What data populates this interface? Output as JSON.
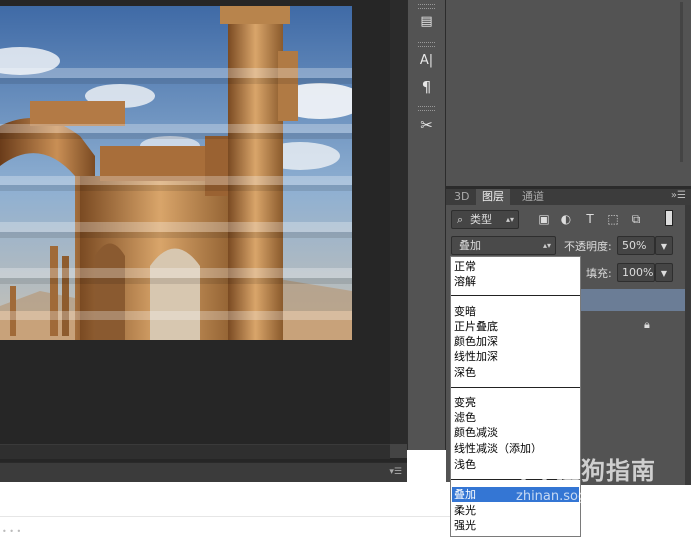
{
  "tools": [
    {
      "icon": "layer-comps-icon",
      "glyph": "▤"
    },
    {
      "icon": "character-icon",
      "glyph": "A|"
    },
    {
      "icon": "paragraph-icon",
      "glyph": "¶"
    },
    {
      "icon": "tool-presets-icon",
      "glyph": "✂"
    }
  ],
  "panel_tabs": [
    "3D",
    "图层",
    "通道"
  ],
  "active_tab": "图层",
  "layers": {
    "filter_type_label": "类型",
    "filter_icons": [
      "image-filter-icon",
      "adjustment-filter-icon",
      "type-filter-icon",
      "shape-filter-icon",
      "smart-object-filter-icon"
    ],
    "blend_mode": "叠加",
    "opacity_label": "不透明度:",
    "opacity_value": "50%",
    "fill_label": "填充:",
    "fill_value": "100%"
  },
  "blend_modes": {
    "group1": [
      "正常",
      "溶解"
    ],
    "group2": [
      "变暗",
      "正片叠底",
      "颜色加深",
      "线性加深",
      "深色"
    ],
    "group3": [
      "变亮",
      "滤色",
      "颜色减淡",
      "线性减淡（添加）",
      "浅色"
    ],
    "group4": [
      "叠加",
      "柔光",
      "强光"
    ],
    "selected": "叠加"
  },
  "watermark": {
    "text": "搜狗指南",
    "url": "zhinan.sogou.com"
  },
  "colors": {
    "panel_bg": "#535353",
    "workspace_bg": "#262626",
    "selection": "#3476d4",
    "layer_selected": "#6b7d96"
  }
}
